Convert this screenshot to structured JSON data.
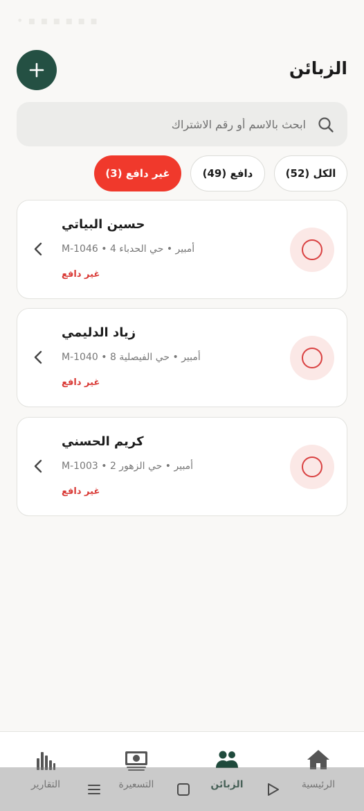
{
  "status_bar": {
    "text": "• ▪ ▪ ▪ ▪ ▪ ▪"
  },
  "header": {
    "title": "الزبائن"
  },
  "search": {
    "placeholder": "ابحث بالاسم أو رقم الاشتراك"
  },
  "filters": [
    {
      "label": "الكل (52)",
      "active": false
    },
    {
      "label": "دافع (49)",
      "active": false
    },
    {
      "label": "غير دافع (3)",
      "active": true
    }
  ],
  "customers": [
    {
      "name": "حسين البياتي",
      "meta": "أمبير • حي الحدباء 4 • M-1046",
      "status": "غير دافع"
    },
    {
      "name": "زياد الدليمي",
      "meta": "أمبير • حي الفيصلية 8 • M-1040",
      "status": "غير دافع"
    },
    {
      "name": "كريم الحسني",
      "meta": "أمبير • حي الزهور 2 • M-1003",
      "status": "غير دافع"
    }
  ],
  "nav": [
    {
      "label": "التقارير",
      "icon": "bar-chart-icon"
    },
    {
      "label": "التسعيرة",
      "icon": "banknote-icon"
    },
    {
      "label": "الزبائن",
      "icon": "users-icon",
      "active": true
    },
    {
      "label": "الرئيسية",
      "icon": "home-icon"
    }
  ],
  "colors": {
    "accent": "#245043",
    "unpaid": "#f0392c",
    "unpaid_text": "#d93a36"
  }
}
